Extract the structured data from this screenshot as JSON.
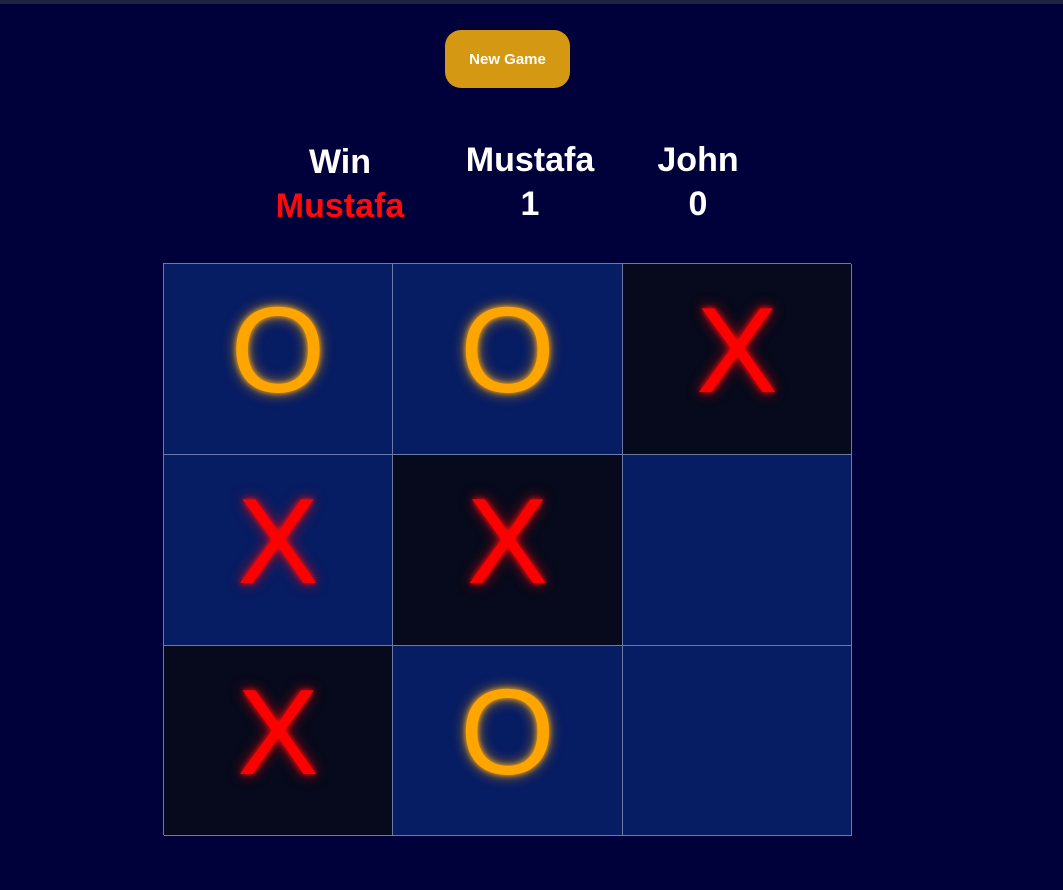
{
  "toolbar": {
    "new_game_label": "New Game"
  },
  "scoreboard": {
    "win_label": "Win",
    "winner_name": "Mustafa",
    "player1": {
      "name": "Mustafa",
      "score": "1"
    },
    "player2": {
      "name": "John",
      "score": "0"
    }
  },
  "board": {
    "cells": [
      {
        "mark": "O",
        "shade": "blue"
      },
      {
        "mark": "O",
        "shade": "blue"
      },
      {
        "mark": "X",
        "shade": "dark"
      },
      {
        "mark": "X",
        "shade": "blue"
      },
      {
        "mark": "X",
        "shade": "dark"
      },
      {
        "mark": "",
        "shade": "blue"
      },
      {
        "mark": "X",
        "shade": "dark"
      },
      {
        "mark": "O",
        "shade": "blue"
      },
      {
        "mark": "",
        "shade": "blue"
      }
    ]
  },
  "colors": {
    "background": "#00003a",
    "button": "#d49812",
    "x_mark": "#ff0000",
    "o_mark": "#ffa500",
    "cell_blue": "#061c63",
    "cell_dark": "#060a1c",
    "winner_text": "#ff0a0a"
  }
}
